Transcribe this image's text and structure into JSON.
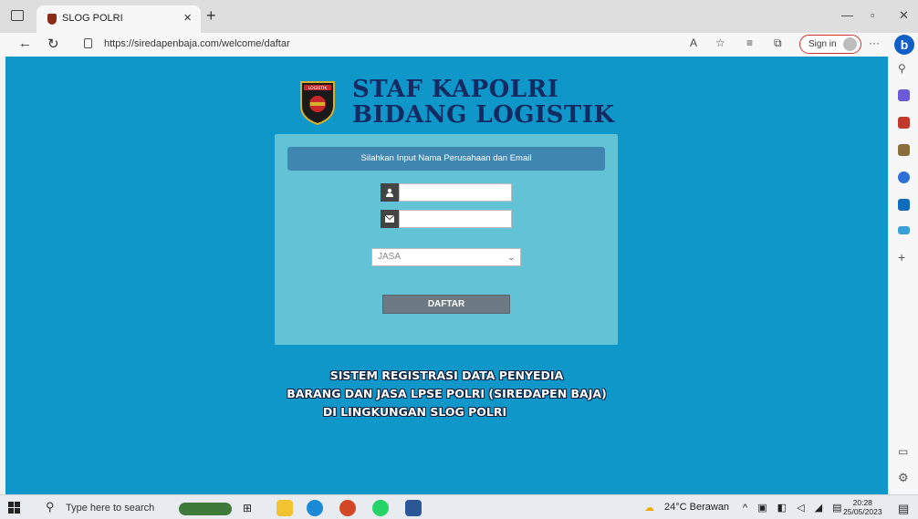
{
  "browser": {
    "tab_title": "SLOG POLRI",
    "url": "https://siredapenbaja.com/welcome/daftar",
    "signin_label": "Sign in",
    "bing_label": "b"
  },
  "page": {
    "header_line1": "STAF KAPOLRI",
    "header_line2": "BIDANG LOGISTIK",
    "logo_text": "LOGISTIK",
    "form_instruction": "Silahkan Input Nama Perusahaan dan Email",
    "company_name_value": "",
    "email_value": "",
    "category_selected": "JASA",
    "submit_label": "DAFTAR",
    "footer_line1": "SISTEM REGISTRASI DATA PENYEDIA",
    "footer_line2": "BARANG DAN JASA LPSE POLRI (SIREDAPEN BAJA)",
    "footer_line3": "DI LINGKUNGAN SLOG POLRI"
  },
  "taskbar": {
    "search_placeholder": "Type here to search",
    "weather": "24°C Berawan",
    "time": "20:28",
    "date": "25/05/2023"
  },
  "colors": {
    "page_bg": "#0e97c8",
    "panel_bg": "#62c3d7",
    "panel_header_bg": "#3f86b0",
    "header_text": "#132a63",
    "button_bg": "#6d7a83"
  },
  "icons": [
    "sidebar-toggle-icon",
    "back-icon",
    "refresh-icon",
    "lock-icon",
    "read-aloud-icon",
    "favorites-add-icon",
    "favorites-icon",
    "collections-icon",
    "more-icon",
    "user-icon",
    "mail-icon",
    "chevron-down-icon",
    "search-icon",
    "windows-start-icon"
  ]
}
